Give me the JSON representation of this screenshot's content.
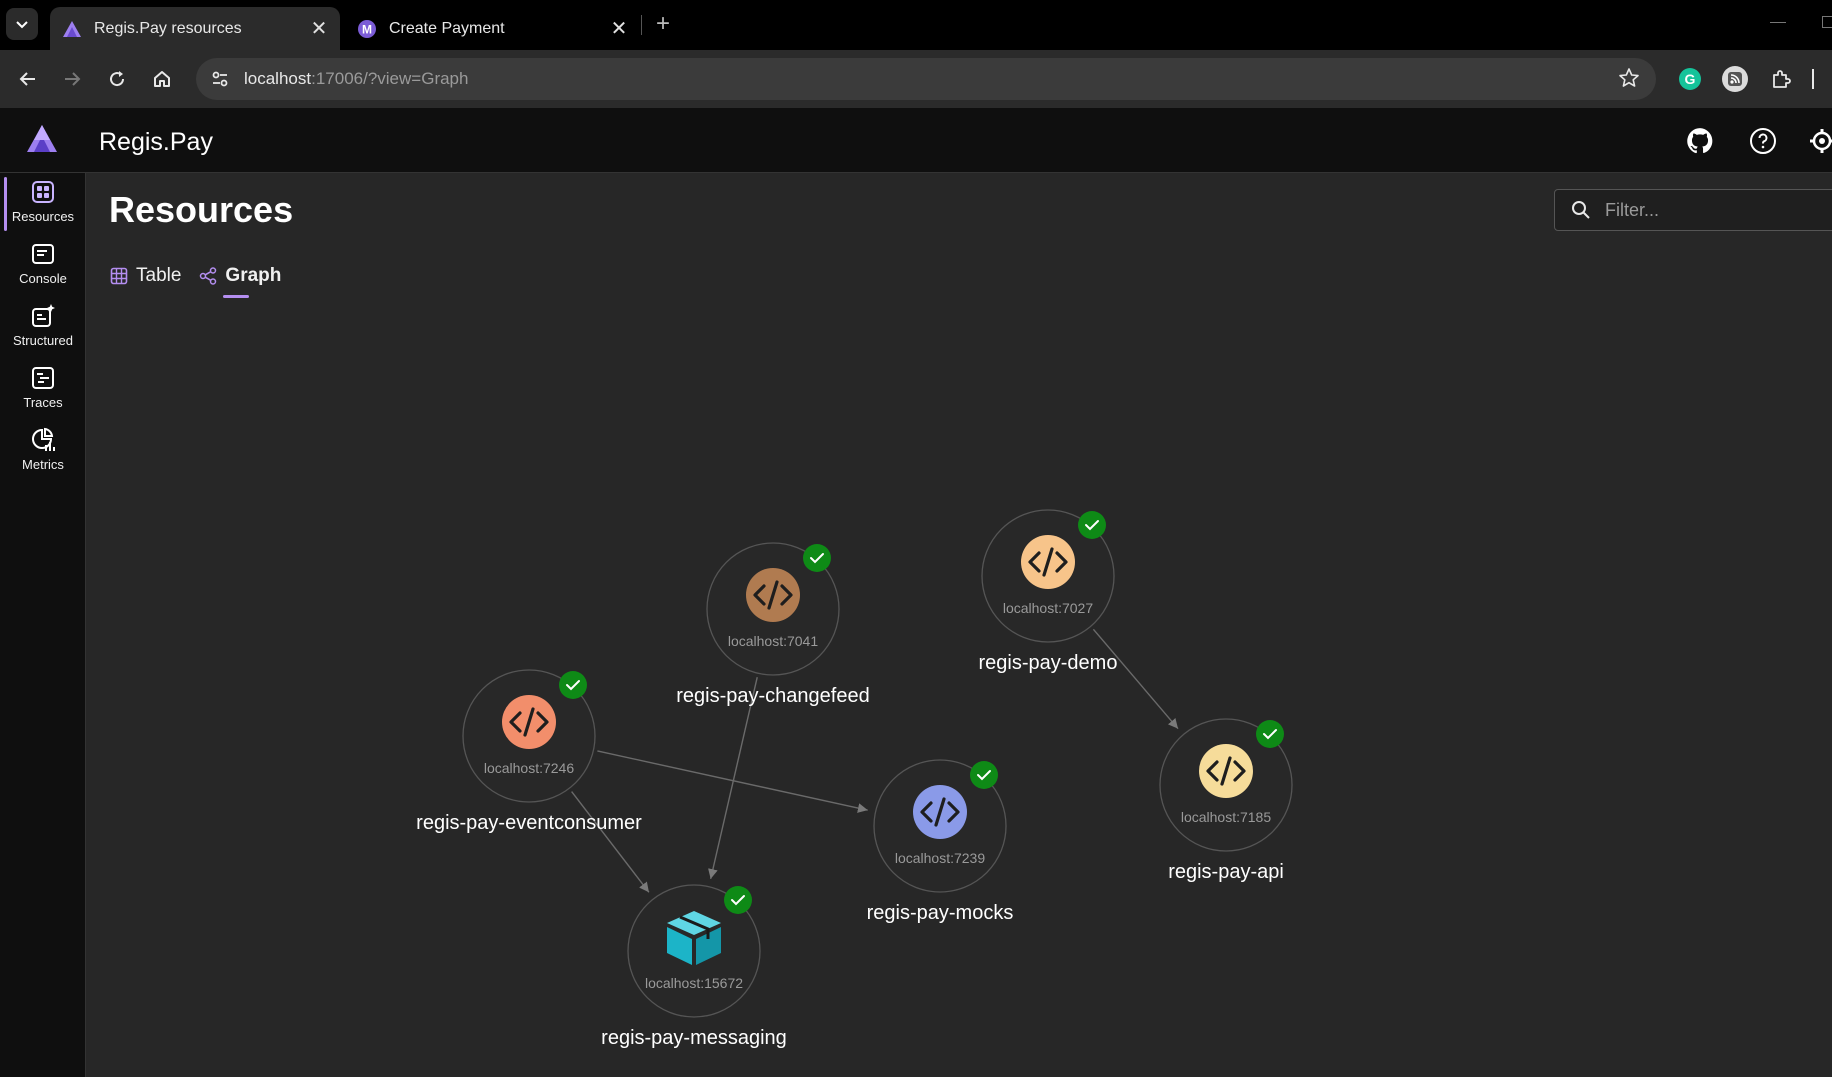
{
  "browser": {
    "tabs": [
      {
        "title": "Regis.Pay resources",
        "active": true
      },
      {
        "title": "Create Payment",
        "active": false
      }
    ],
    "address": {
      "host": "localhost",
      "path": ":17006/?view=Graph"
    }
  },
  "app": {
    "name": "Regis.Pay",
    "brand_color": "#8a67e0"
  },
  "sidenav": {
    "items": [
      {
        "label": "Resources",
        "icon": "grid-icon",
        "active": true
      },
      {
        "label": "Console",
        "icon": "console-icon",
        "active": false
      },
      {
        "label": "Structured",
        "icon": "structured-logs-icon",
        "active": false
      },
      {
        "label": "Traces",
        "icon": "traces-icon",
        "active": false
      },
      {
        "label": "Metrics",
        "icon": "metrics-icon",
        "active": false
      }
    ]
  },
  "page": {
    "title": "Resources",
    "filter_placeholder": "Filter...",
    "view_tabs": [
      {
        "label": "Table",
        "active": false
      },
      {
        "label": "Graph",
        "active": true
      }
    ]
  },
  "graph": {
    "nodes": [
      {
        "id": "changefeed",
        "name": "regis-pay-changefeed",
        "endpoint": "localhost:7041",
        "icon": "code-icon",
        "color": "#b07b50",
        "status": "running"
      },
      {
        "id": "demo",
        "name": "regis-pay-demo",
        "endpoint": "localhost:7027",
        "icon": "code-icon",
        "color": "#f7c48a",
        "status": "running"
      },
      {
        "id": "eventconsumer",
        "name": "regis-pay-eventconsumer",
        "endpoint": "localhost:7246",
        "icon": "code-icon",
        "color": "#f28e6b",
        "status": "running"
      },
      {
        "id": "mocks",
        "name": "regis-pay-mocks",
        "endpoint": "localhost:7239",
        "icon": "code-icon",
        "color": "#8a9ae8",
        "status": "running"
      },
      {
        "id": "api",
        "name": "regis-pay-api",
        "endpoint": "localhost:7185",
        "icon": "code-icon",
        "color": "#f6dc9a",
        "status": "running"
      },
      {
        "id": "messaging",
        "name": "regis-pay-messaging",
        "endpoint": "localhost:15672",
        "icon": "container-icon",
        "color": "#1cb4c8",
        "status": "running"
      }
    ],
    "edges": [
      {
        "from": "changefeed",
        "to": "messaging"
      },
      {
        "from": "eventconsumer",
        "to": "messaging"
      },
      {
        "from": "eventconsumer",
        "to": "mocks"
      },
      {
        "from": "demo",
        "to": "api"
      }
    ],
    "status_color": "#0e8a16"
  }
}
